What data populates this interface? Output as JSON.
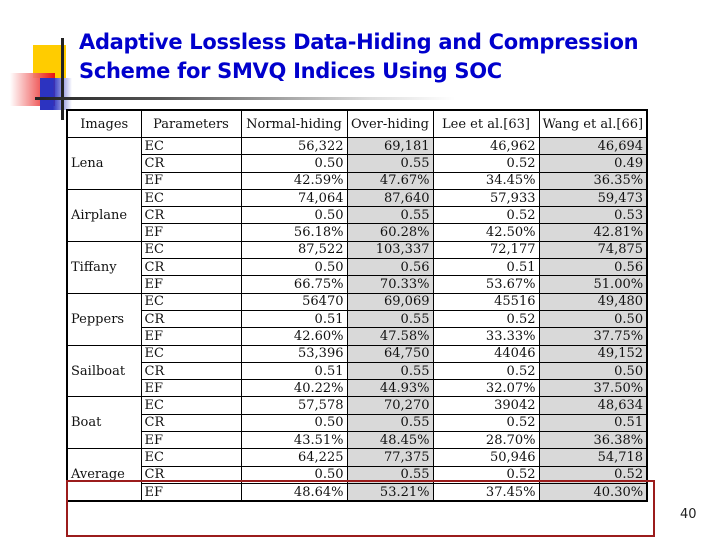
{
  "slide": {
    "title_line1": "Adaptive Lossless Data-Hiding and Compression",
    "title_line2": "Scheme for SMVQ Indices Using SOC",
    "page_number": "40",
    "accent_colors": {
      "title": "#0000cc",
      "highlight_border": "#9b1c1c",
      "shaded_cell": "#d9d9d9"
    }
  },
  "table": {
    "headers": [
      "Images",
      "Parameters",
      "Normal-hiding",
      "Over-hiding",
      "Lee et al.[63]",
      "Wang et al.[66]"
    ],
    "groups": [
      {
        "image": "Lena",
        "rows": [
          [
            "EC",
            "56,322",
            "69,181",
            "46,962",
            "46,694"
          ],
          [
            "CR",
            "0.50",
            "0.55",
            "0.52",
            "0.49"
          ],
          [
            "EF",
            "42.59%",
            "47.67%",
            "34.45%",
            "36.35%"
          ]
        ]
      },
      {
        "image": "Airplane",
        "rows": [
          [
            "EC",
            "74,064",
            "87,640",
            "57,933",
            "59,473"
          ],
          [
            "CR",
            "0.50",
            "0.55",
            "0.52",
            "0.53"
          ],
          [
            "EF",
            "56.18%",
            "60.28%",
            "42.50%",
            "42.81%"
          ]
        ]
      },
      {
        "image": "Tiffany",
        "rows": [
          [
            "EC",
            "87,522",
            "103,337",
            "72,177",
            "74,875"
          ],
          [
            "CR",
            "0.50",
            "0.56",
            "0.51",
            "0.56"
          ],
          [
            "EF",
            "66.75%",
            "70.33%",
            "53.67%",
            "51.00%"
          ]
        ]
      },
      {
        "image": "Peppers",
        "rows": [
          [
            "EC",
            "56470",
            "69,069",
            "45516",
            "49,480"
          ],
          [
            "CR",
            "0.51",
            "0.55",
            "0.52",
            "0.50"
          ],
          [
            "EF",
            "42.60%",
            "47.58%",
            "33.33%",
            "37.75%"
          ]
        ]
      },
      {
        "image": "Sailboat",
        "rows": [
          [
            "EC",
            "53,396",
            "64,750",
            "44046",
            "49,152"
          ],
          [
            "CR",
            "0.51",
            "0.55",
            "0.52",
            "0.50"
          ],
          [
            "EF",
            "40.22%",
            "44.93%",
            "32.07%",
            "37.50%"
          ]
        ]
      },
      {
        "image": "Boat",
        "rows": [
          [
            "EC",
            "57,578",
            "70,270",
            "39042",
            "48,634"
          ],
          [
            "CR",
            "0.50",
            "0.55",
            "0.52",
            "0.51"
          ],
          [
            "EF",
            "43.51%",
            "48.45%",
            "28.70%",
            "36.38%"
          ]
        ]
      },
      {
        "image": "Average",
        "highlighted": true,
        "rows": [
          [
            "EC",
            "64,225",
            "77,375",
            "50,946",
            "54,718"
          ],
          [
            "CR",
            "0.50",
            "0.55",
            "0.52",
            "0.52"
          ],
          [
            "EF",
            "48.64%",
            "53.21%",
            "37.45%",
            "40.30%"
          ]
        ]
      }
    ]
  }
}
